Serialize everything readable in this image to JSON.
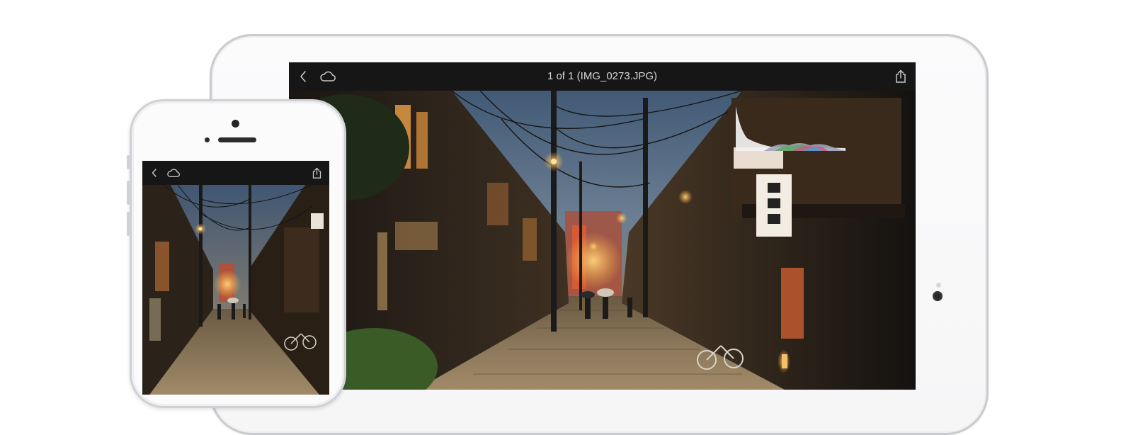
{
  "tablet": {
    "toolbar": {
      "title": "1 of 1 (IMG_0273.JPG)",
      "back_icon": "chevron-left-icon",
      "cloud_icon": "cloud-icon",
      "share_icon": "share-icon"
    }
  },
  "phone": {
    "toolbar": {
      "back_icon": "chevron-left-icon",
      "cloud_icon": "cloud-icon",
      "share_icon": "share-icon"
    }
  },
  "colors": {
    "toolbar_bg": "#161617",
    "toolbar_icon": "#c8c8c8",
    "sky": "#3b4f68",
    "lantern": "#f3b24a"
  }
}
